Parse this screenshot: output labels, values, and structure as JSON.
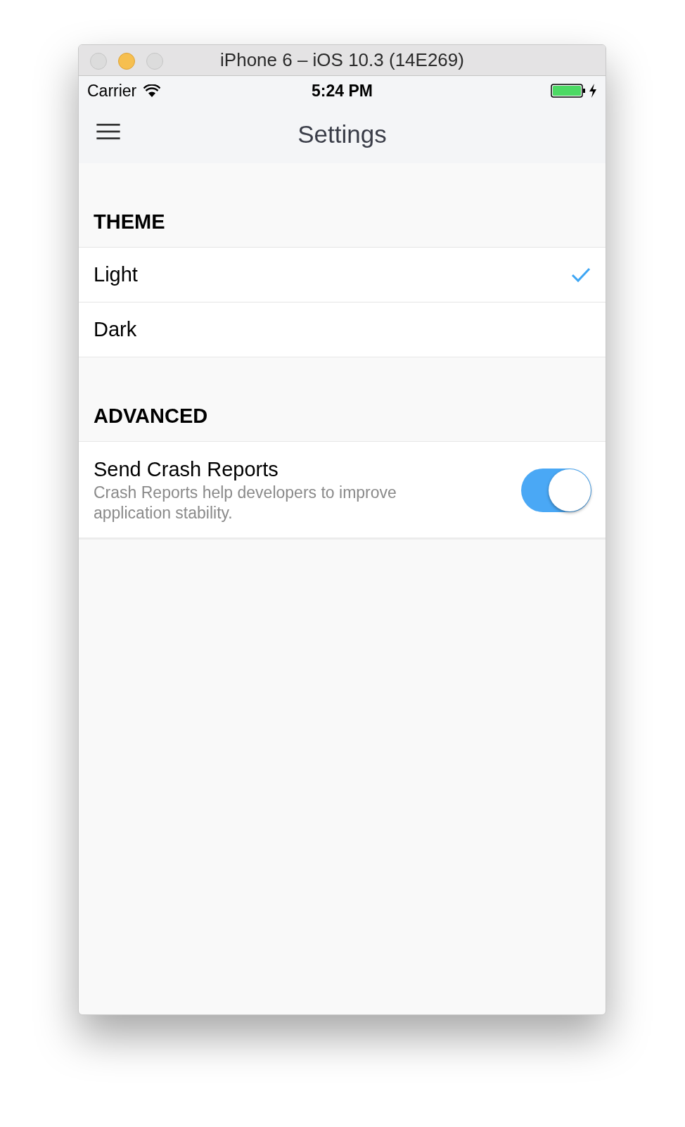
{
  "window": {
    "title": "iPhone 6 – iOS 10.3 (14E269)"
  },
  "status_bar": {
    "carrier": "Carrier",
    "time": "5:24 PM",
    "charging": true
  },
  "nav": {
    "title": "Settings"
  },
  "sections": [
    {
      "header": "THEME",
      "rows": [
        {
          "kind": "choice",
          "label": "Light",
          "selected": true
        },
        {
          "kind": "choice",
          "label": "Dark",
          "selected": false
        }
      ]
    },
    {
      "header": "ADVANCED",
      "rows": [
        {
          "kind": "toggle",
          "label": "Send Crash Reports",
          "detail": "Crash Reports help developers to improve application stability.",
          "on": true
        }
      ]
    }
  ]
}
